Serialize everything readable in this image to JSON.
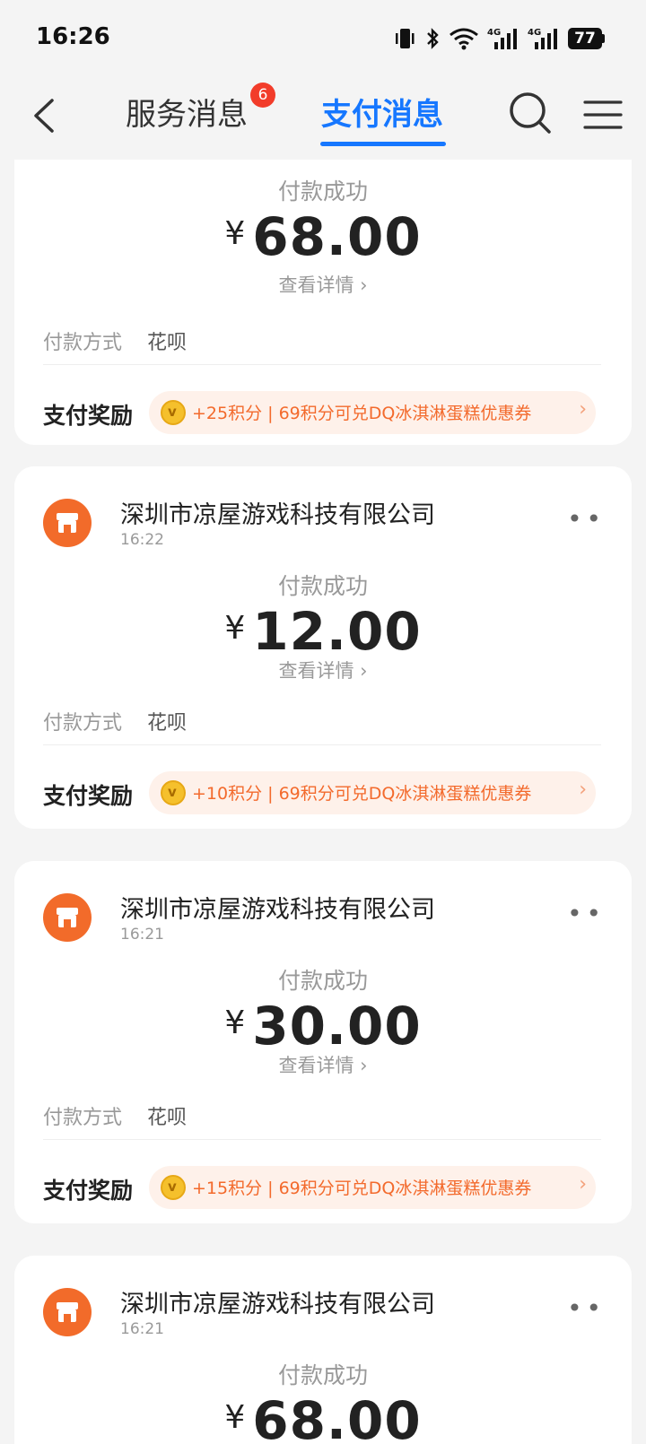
{
  "status_bar": {
    "time": "16:26",
    "battery": "77"
  },
  "nav": {
    "tabs": [
      {
        "label": "服务消息",
        "badge": "6"
      },
      {
        "label": "支付消息"
      }
    ]
  },
  "cards": [
    {
      "status": "付款成功",
      "currency": "¥",
      "amount": "68.00",
      "detail": "查看详情",
      "method_label": "付款方式",
      "method_value": "花呗",
      "reward_label": "支付奖励",
      "reward_text": "+25积分 | 69积分可兑DQ冰淇淋蛋糕优惠券"
    },
    {
      "merchant": "深圳市凉屋游戏科技有限公司",
      "time": "16:22",
      "status": "付款成功",
      "currency": "¥",
      "amount": "12.00",
      "detail": "查看详情",
      "method_label": "付款方式",
      "method_value": "花呗",
      "reward_label": "支付奖励",
      "reward_text": "+10积分 | 69积分可兑DQ冰淇淋蛋糕优惠券"
    },
    {
      "merchant": "深圳市凉屋游戏科技有限公司",
      "time": "16:21",
      "status": "付款成功",
      "currency": "¥",
      "amount": "30.00",
      "detail": "查看详情",
      "method_label": "付款方式",
      "method_value": "花呗",
      "reward_label": "支付奖励",
      "reward_text": "+15积分 | 69积分可兑DQ冰淇淋蛋糕优惠券"
    },
    {
      "merchant": "深圳市凉屋游戏科技有限公司",
      "time": "16:21",
      "status": "付款成功",
      "currency": "¥",
      "amount": "68.00"
    }
  ],
  "colors": {
    "accent": "#1677ff",
    "merchant_icon": "#f26b2a",
    "reward_text": "#f36a2c",
    "badge": "#f23c2a"
  },
  "icons": [
    "back-arrow-icon",
    "search-icon",
    "menu-icon",
    "store-icon",
    "coin-icon",
    "chevron-right-icon",
    "more-icon"
  ]
}
